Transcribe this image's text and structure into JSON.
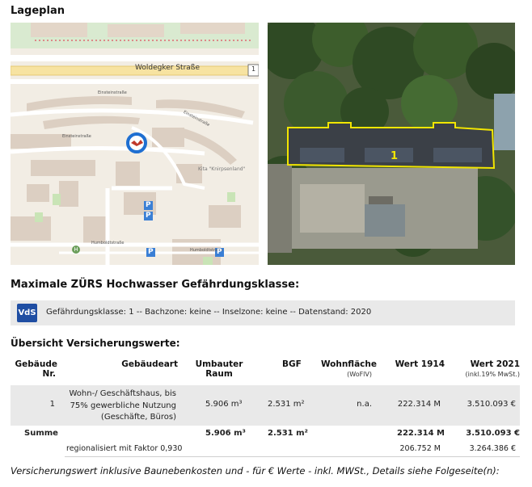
{
  "page": {
    "lageplan_title": "Lageplan",
    "hochwasser_title": "Maximale ZÜRS Hochwasser Gefährdungsklasse:",
    "uebersicht_title": "Übersicht Versicherungswerte:",
    "footer_note": "Versicherungswert inklusive Baunebenkosten und - für € Werte - inkl. MWSt., Details siehe Folgeseite(n):"
  },
  "map": {
    "street_main": "Woldegker Straße",
    "street_2": "Einsteinstraße",
    "street_3": "Einsteinstraße",
    "street_4": "Einsteinstraße",
    "street_5": "Humboldtstraße",
    "street_6": "Humboldtstraße",
    "kita_label": "Kita \"Knirpsenland\"",
    "road_number": "1",
    "parking_symbol": "P",
    "bus_symbol": "H",
    "colors": {
      "map_bg": "#f2ede4",
      "road": "#ffffff",
      "building": "#dccfc2",
      "green": "#c9e4b6",
      "main_road": "#f7e3a1",
      "marker": "#1f6fd1"
    }
  },
  "satellite": {
    "building_label": "1",
    "colors": {
      "outline": "#f2e600",
      "roof": "#3b4047",
      "tree": "#2f4a24"
    }
  },
  "vds": {
    "logo_text": "VdS",
    "info": "Gefährdungsklasse: 1 -- Bachzone: keine -- Inselzone: keine -- Datenstand: 2020",
    "logo_color": "#1f4ea3"
  },
  "table": {
    "headers": {
      "gebaeude_nr_1": "Gebäude",
      "gebaeude_nr_2": "Nr.",
      "gebaeudeart": "Gebäudeart",
      "umbauter_1": "Umbauter",
      "umbauter_2": "Raum",
      "bgf": "BGF",
      "wohnflaeche": "Wohnfläche",
      "wohnflaeche_sub": "(WoFlV)",
      "wert1914": "Wert 1914",
      "wert2021": "Wert 2021",
      "wert2021_sub": "(inkl.19% MwSt.)"
    },
    "row": {
      "nr": "1",
      "art_1": "Wohn-/ Geschäftshaus, bis",
      "art_2": "75% gewerbliche Nutzung",
      "art_3": "(Geschäfte, Büros)",
      "raum": "5.906 m³",
      "bgf": "2.531 m²",
      "wohnflaeche": "n.a.",
      "wert1914": "222.314 M",
      "wert2021": "3.510.093 €"
    },
    "summe": {
      "label": "Summe",
      "raum": "5.906 m³",
      "bgf": "2.531 m²",
      "wert1914": "222.314 M",
      "wert2021": "3.510.093 €"
    },
    "regional": {
      "label": "regionalisiert mit Faktor 0,930",
      "wert1914": "206.752 M",
      "wert2021": "3.264.386 €"
    }
  }
}
